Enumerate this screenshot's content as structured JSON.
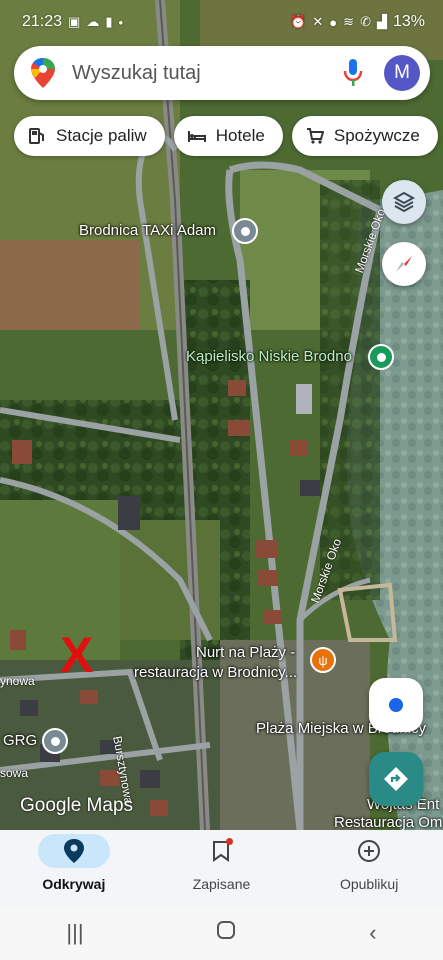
{
  "status_bar": {
    "time": "21:23",
    "battery": "13%"
  },
  "search": {
    "placeholder": "Wyszukaj tutaj",
    "avatar_letter": "M"
  },
  "chips": [
    {
      "label": "Stacje paliw",
      "icon": "gas-station-icon"
    },
    {
      "label": "Hotele",
      "icon": "bed-icon"
    },
    {
      "label": "Spożywcze",
      "icon": "cart-icon"
    }
  ],
  "map": {
    "places": [
      {
        "name": "Brodnica TAXi Adam",
        "icon": "grey-pin"
      },
      {
        "name": "Kąpielisko Niskie Brodno",
        "icon": "green-pin"
      },
      {
        "name_line1": "Nurt na Plaży -",
        "name_line2": "restauracja w Brodnicy...",
        "icon": "restaurant-pin"
      },
      {
        "name": "Plaża Miejska w Brodnicy"
      },
      {
        "name": "GRG",
        "icon": "grey-pin"
      },
      {
        "name": "Wojtas Ent"
      },
      {
        "name": "Restauracja Om"
      }
    ],
    "roads": [
      "Morskie Oko",
      "Morskie Oko",
      "Bursztynowa",
      "ynowa",
      "sowa"
    ],
    "attribution": "Google Maps",
    "marker": "X"
  },
  "bottom_nav": [
    {
      "label": "Odkrywaj",
      "icon": "explore-pin-icon",
      "active": true
    },
    {
      "label": "Zapisane",
      "icon": "bookmark-icon",
      "active": false
    },
    {
      "label": "Opublikuj",
      "icon": "add-circle-icon",
      "active": false
    }
  ],
  "colors": {
    "accent": "#1a66e8",
    "nav_active": "#c9e6fa",
    "directions": "#2a8a86",
    "avatar": "#5458c6"
  }
}
